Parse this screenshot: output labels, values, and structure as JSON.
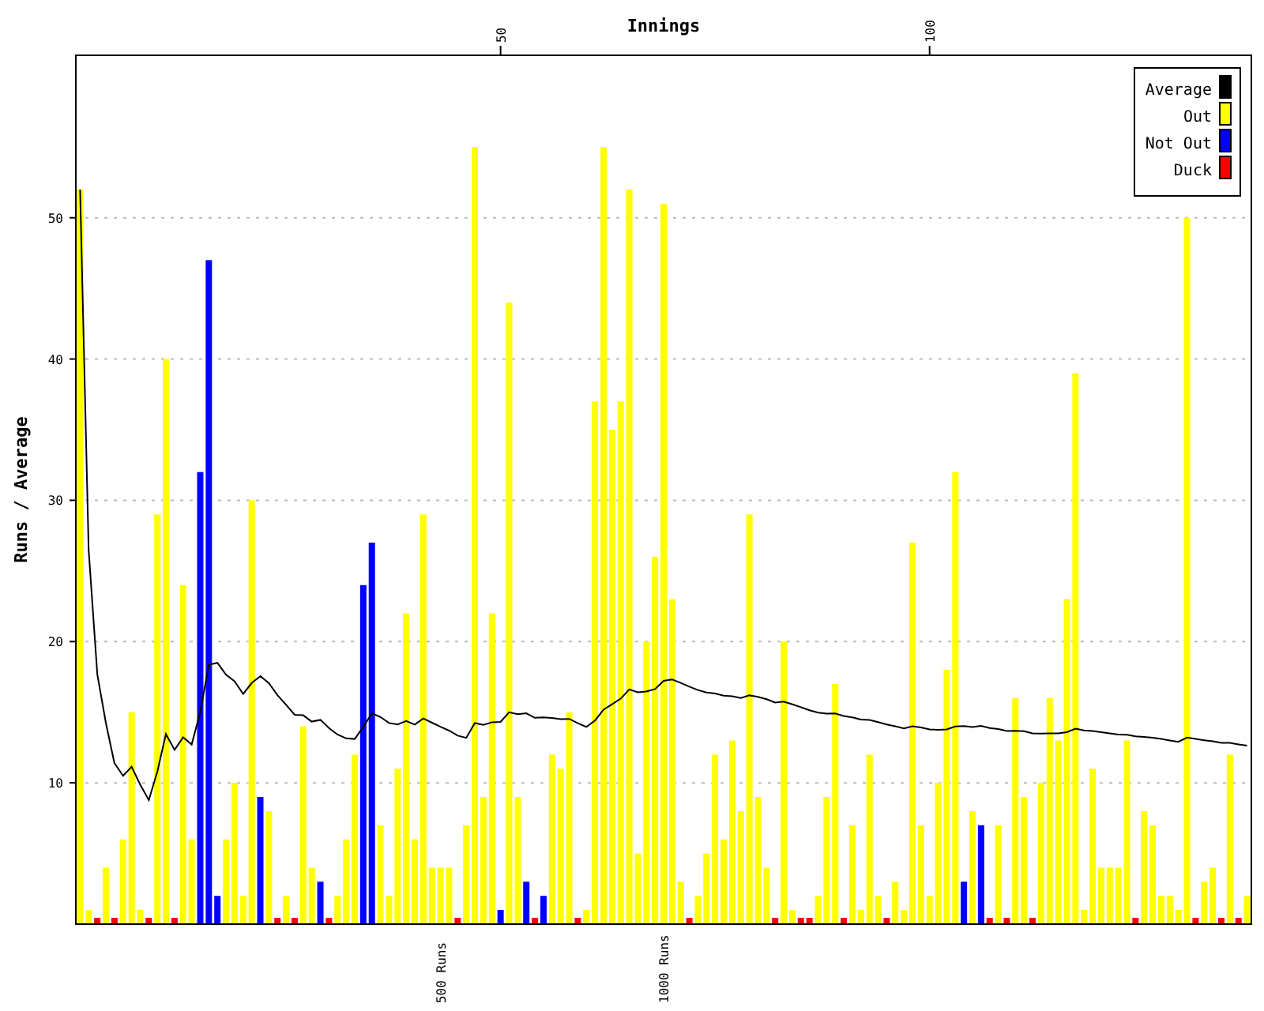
{
  "chart_data": {
    "type": "bar",
    "title": "Innings",
    "ylabel": "Runs / Average",
    "grid": true,
    "legend": true,
    "x": [
      1,
      2,
      3,
      4,
      5,
      6,
      7,
      8,
      9,
      10,
      11,
      12,
      13,
      14,
      15,
      16,
      17,
      18,
      19,
      20,
      21,
      22,
      23,
      24,
      25,
      26,
      27,
      28,
      29,
      30,
      31,
      32,
      33,
      34,
      35,
      36,
      37,
      38,
      39,
      40,
      41,
      42,
      43,
      44,
      45,
      46,
      47,
      48,
      49,
      50,
      51,
      52,
      53,
      54,
      55,
      56,
      57,
      58,
      59,
      60,
      61,
      62,
      63,
      64,
      65,
      66,
      67,
      68,
      69,
      70,
      71,
      72,
      73,
      74,
      75,
      76,
      77,
      78,
      79,
      80,
      81,
      82,
      83,
      84,
      85,
      86,
      87,
      88,
      89,
      90,
      91,
      92,
      93,
      94,
      95,
      96,
      97,
      98,
      99,
      100,
      101,
      102,
      103,
      104,
      105,
      106,
      107,
      108,
      109,
      110,
      111,
      112,
      113,
      114,
      115,
      116,
      117,
      118,
      119,
      120,
      121,
      122,
      123,
      124,
      125,
      126,
      127,
      128,
      129,
      130,
      131,
      132,
      133,
      134,
      135,
      136,
      137
    ],
    "xlim": [
      0.5,
      137.5
    ],
    "ylim": [
      0,
      61.5
    ],
    "xticks": [
      {
        "value": 50,
        "label": "50"
      },
      {
        "value": 100,
        "label": "100"
      }
    ],
    "yticks": [
      10,
      20,
      30,
      40,
      50
    ],
    "series": [
      {
        "name": "Average",
        "color": "#000000",
        "type": "line",
        "values": [
          52.0,
          26.5,
          17.67,
          14.25,
          11.4,
          10.5,
          11.14,
          9.88,
          8.78,
          10.8,
          13.45,
          12.33,
          13.23,
          12.71,
          15.0,
          18.36,
          18.5,
          17.67,
          17.19,
          16.29,
          17.06,
          17.56,
          17.05,
          16.2,
          15.52,
          14.82,
          14.78,
          14.33,
          14.46,
          13.88,
          13.42,
          13.15,
          13.11,
          13.96,
          14.93,
          14.66,
          14.23,
          14.13,
          14.38,
          14.12,
          14.56,
          14.26,
          13.97,
          13.7,
          13.34,
          13.18,
          14.23,
          14.1,
          14.29,
          14.31,
          15.0,
          14.86,
          14.93,
          14.6,
          14.64,
          14.59,
          14.51,
          14.52,
          14.22,
          13.96,
          14.41,
          15.19,
          15.57,
          15.96,
          16.62,
          16.41,
          16.47,
          16.64,
          17.22,
          17.32,
          17.08,
          16.81,
          16.57,
          16.39,
          16.32,
          16.17,
          16.12,
          16.0,
          16.19,
          16.09,
          15.92,
          15.69,
          15.75,
          15.55,
          15.35,
          15.14,
          14.97,
          14.9,
          14.92,
          14.74,
          14.64,
          14.48,
          14.45,
          14.3,
          14.13,
          14.0,
          13.85,
          14.0,
          13.92,
          13.79,
          13.75,
          13.79,
          13.99,
          14.02,
          13.96,
          14.03,
          13.88,
          13.81,
          13.67,
          13.69,
          13.65,
          13.51,
          13.48,
          13.5,
          13.5,
          13.59,
          13.83,
          13.71,
          13.68,
          13.59,
          13.5,
          13.42,
          13.41,
          13.29,
          13.25,
          13.19,
          13.1,
          13.0,
          12.9,
          13.21,
          13.1,
          13.02,
          12.94,
          12.84,
          12.83,
          12.73,
          12.64
        ]
      },
      {
        "name": "Out",
        "color": "#ffff00",
        "type": "bar",
        "values": [
          52,
          1,
          null,
          4,
          null,
          6,
          15,
          1,
          null,
          29,
          40,
          null,
          24,
          6,
          null,
          null,
          null,
          6,
          10,
          2,
          30,
          null,
          8,
          null,
          2,
          null,
          14,
          4,
          null,
          null,
          2,
          6,
          12,
          null,
          null,
          7,
          2,
          11,
          22,
          6,
          29,
          4,
          4,
          4,
          null,
          7,
          55,
          9,
          22,
          null,
          44,
          9,
          null,
          null,
          null,
          12,
          11,
          15,
          null,
          1,
          37,
          55,
          35,
          37,
          52,
          5,
          20,
          26,
          51,
          23,
          3,
          null,
          2,
          5,
          12,
          6,
          13,
          8,
          29,
          9,
          4,
          null,
          20,
          1,
          null,
          null,
          2,
          9,
          17,
          null,
          7,
          1,
          12,
          2,
          null,
          3,
          1,
          27,
          7,
          2,
          10,
          18,
          32,
          null,
          8,
          null,
          null,
          7,
          null,
          16,
          9,
          null,
          10,
          16,
          13,
          23,
          39,
          1,
          11,
          4,
          4,
          4,
          13,
          null,
          8,
          7,
          2,
          2,
          1,
          50,
          null,
          3,
          4,
          null,
          12,
          null,
          2
        ]
      },
      {
        "name": "Not Out",
        "color": "#0000ff",
        "type": "bar",
        "values": [
          null,
          null,
          null,
          null,
          null,
          null,
          null,
          null,
          null,
          null,
          null,
          null,
          null,
          null,
          32,
          47,
          2,
          null,
          null,
          null,
          null,
          9,
          null,
          null,
          null,
          null,
          null,
          null,
          3,
          null,
          null,
          null,
          null,
          24,
          27,
          null,
          null,
          null,
          null,
          null,
          null,
          null,
          null,
          null,
          null,
          null,
          null,
          null,
          null,
          1,
          null,
          null,
          3,
          null,
          2,
          null,
          null,
          null,
          null,
          null,
          null,
          null,
          null,
          null,
          null,
          null,
          null,
          null,
          null,
          null,
          null,
          null,
          null,
          null,
          null,
          null,
          null,
          null,
          null,
          null,
          null,
          null,
          null,
          null,
          null,
          null,
          null,
          null,
          null,
          null,
          null,
          null,
          null,
          null,
          null,
          null,
          null,
          null,
          null,
          null,
          null,
          null,
          null,
          3,
          null,
          7,
          null,
          null,
          null,
          null,
          null,
          null,
          null,
          null,
          null,
          null,
          null,
          null,
          null,
          null,
          null,
          null,
          null,
          null,
          null,
          null,
          null,
          null,
          null,
          null,
          null,
          null,
          null,
          null,
          null,
          null,
          null
        ]
      },
      {
        "name": "Duck",
        "color": "#ff0000",
        "type": "scatter",
        "values": [
          null,
          null,
          0,
          null,
          0,
          null,
          null,
          null,
          0,
          null,
          null,
          0,
          null,
          null,
          null,
          null,
          null,
          null,
          null,
          null,
          null,
          null,
          null,
          0,
          null,
          0,
          null,
          null,
          null,
          0,
          null,
          null,
          null,
          null,
          null,
          null,
          null,
          null,
          null,
          null,
          null,
          null,
          null,
          null,
          0,
          null,
          null,
          null,
          null,
          null,
          null,
          null,
          null,
          0,
          null,
          null,
          null,
          null,
          0,
          null,
          null,
          null,
          null,
          null,
          null,
          null,
          null,
          null,
          null,
          null,
          null,
          0,
          null,
          null,
          null,
          null,
          null,
          null,
          null,
          null,
          null,
          0,
          null,
          null,
          0,
          0,
          null,
          null,
          null,
          0,
          null,
          null,
          null,
          null,
          0,
          null,
          null,
          null,
          null,
          null,
          null,
          null,
          null,
          null,
          null,
          null,
          0,
          null,
          0,
          null,
          null,
          0,
          null,
          null,
          null,
          null,
          null,
          null,
          null,
          null,
          null,
          null,
          null,
          0,
          null,
          null,
          null,
          null,
          null,
          null,
          0,
          null,
          null,
          0,
          null,
          0,
          null
        ]
      }
    ],
    "annotations": [
      "500 Runs",
      "1000 Runs"
    ]
  }
}
